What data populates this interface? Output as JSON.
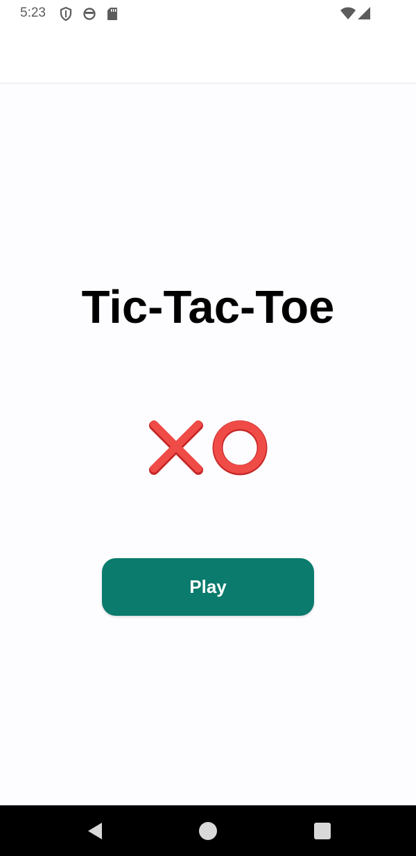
{
  "status_bar": {
    "time": "5:23",
    "left_icons": [
      "shield-icon",
      "sync-icon",
      "sd-card-icon"
    ],
    "right_icons": [
      "wifi-icon",
      "cell-signal-icon"
    ]
  },
  "main": {
    "title": "Tic-Tac-Toe",
    "logo_icons": [
      "x-mark-icon",
      "o-mark-icon"
    ],
    "logo_color": "#e53935",
    "play_button_label": "Play",
    "play_button_color": "#0a7b6d"
  },
  "nav_bar": {
    "buttons": [
      "back-icon",
      "home-icon",
      "recents-icon"
    ]
  }
}
